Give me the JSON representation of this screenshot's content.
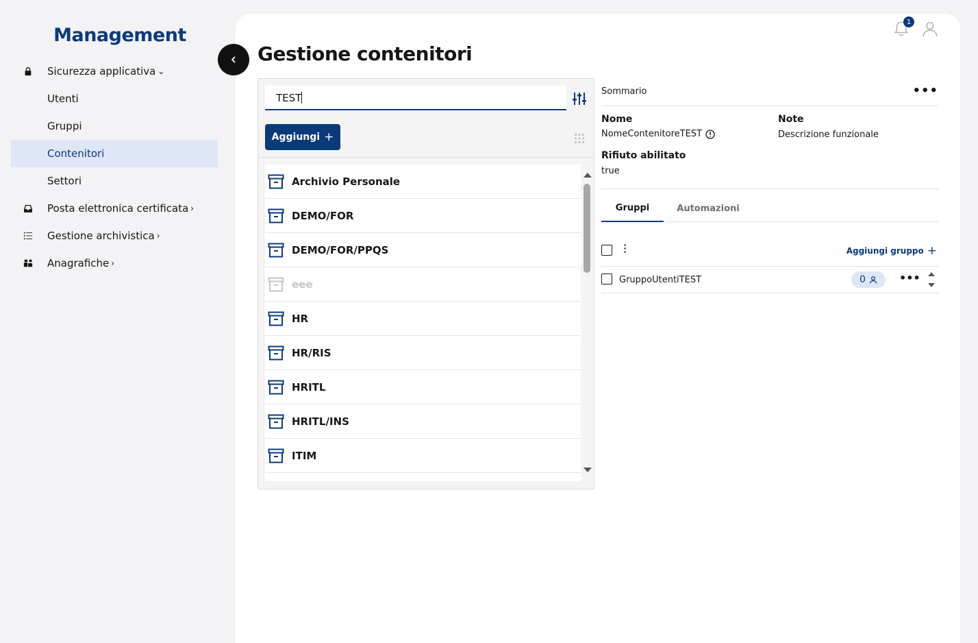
{
  "sidebar": {
    "brand": "Management",
    "items": [
      {
        "label": "Sicurezza applicativa",
        "icon": "lock-icon",
        "chevron": "⌄"
      },
      {
        "label": "Utenti"
      },
      {
        "label": "Gruppi"
      },
      {
        "label": "Contenitori",
        "active": true
      },
      {
        "label": "Settori"
      },
      {
        "label": "Posta elettronica certificata",
        "icon": "inbox-icon",
        "chevron": "›"
      },
      {
        "label": "Gestione archivistica",
        "icon": "list-icon",
        "chevron": "›"
      },
      {
        "label": "Anagrafiche",
        "icon": "category-icon",
        "chevron": "›"
      }
    ]
  },
  "header": {
    "title": "Gestione contenitori",
    "notification_count": "1"
  },
  "list": {
    "search_value": "TEST",
    "add_label": "Aggiungi",
    "items": [
      {
        "label": "Archivio Personale"
      },
      {
        "label": "DEMO/FOR"
      },
      {
        "label": "DEMO/FOR/PPQS"
      },
      {
        "label": "eee",
        "disabled": true
      },
      {
        "label": "HR"
      },
      {
        "label": "HR/RIS"
      },
      {
        "label": "HRITL"
      },
      {
        "label": "HRITL/INS"
      },
      {
        "label": "ITIM"
      }
    ]
  },
  "summary": {
    "title": "Sommario",
    "more": "•••",
    "name_label": "Nome",
    "name_value": "NomeContenitoreTEST",
    "note_label": "Note",
    "note_value": "Descrizione funzionale",
    "reject_label": "Rifiuto abilitato",
    "reject_value": "true",
    "tabs": [
      "Gruppi",
      "Automazioni"
    ],
    "add_group_label": "Aggiungi gruppo",
    "groups": [
      {
        "name": "GruppoUtentiTEST",
        "count": "0"
      }
    ]
  },
  "colors": {
    "brand": "#0b3a7a",
    "active_bg": "#dfe6f7"
  }
}
